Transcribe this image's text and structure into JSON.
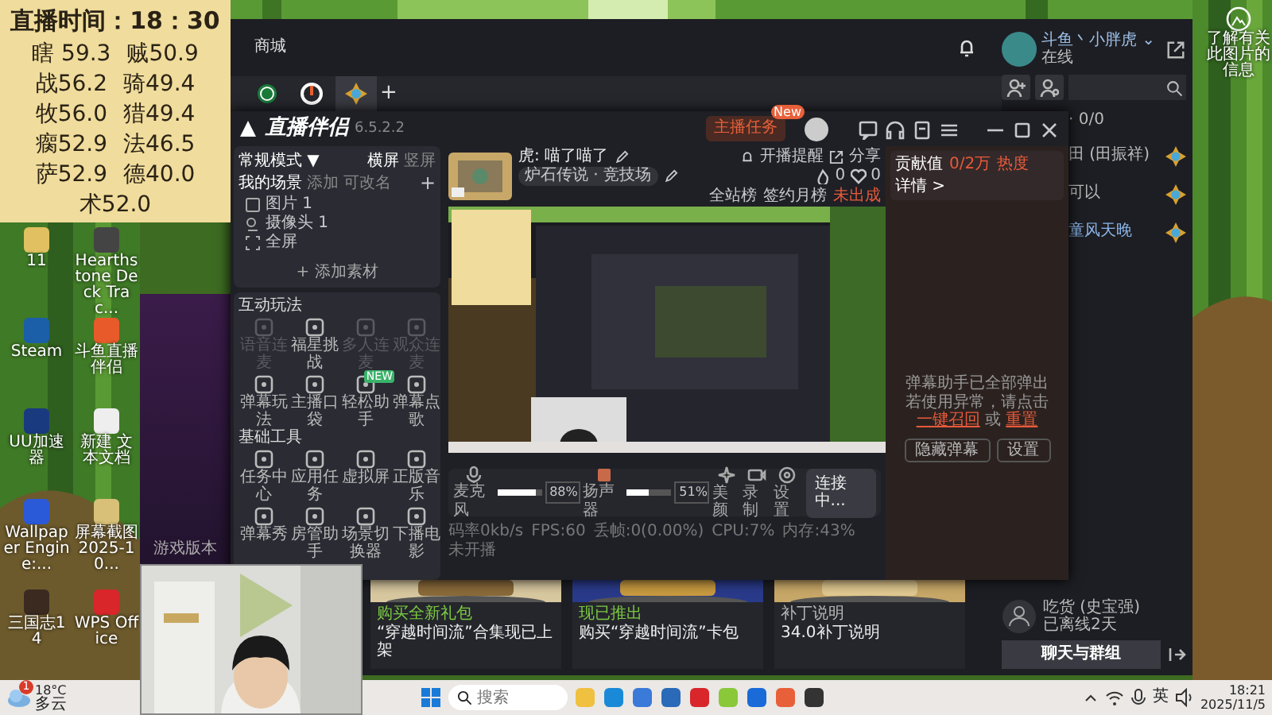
{
  "overlay_note": {
    "title": "直播时间：18：30",
    "rows": [
      [
        "瞎 59.3",
        "贼50.9"
      ],
      [
        "战56.2",
        "骑49.4"
      ],
      [
        "牧56.0",
        "猎49.4"
      ],
      [
        "瘸52.9",
        "法46.5"
      ],
      [
        "萨52.9",
        "德40.0"
      ],
      [
        "术52.0"
      ]
    ]
  },
  "desktop_icons": [
    {
      "label": "11"
    },
    {
      "label": "Hearthstone Deck Trac..."
    },
    {
      "label": "Steam"
    },
    {
      "label": "斗鱼直播伴侣"
    },
    {
      "label": "UU加速器"
    },
    {
      "label": "新建 文本文档"
    },
    {
      "label": "Wallpaper Engine:..."
    },
    {
      "label": "屏幕截图 2025-10..."
    },
    {
      "label": "三国志14"
    },
    {
      "label": "WPS Office"
    }
  ],
  "desktop_info": {
    "label": "了解有关此图片的信息"
  },
  "background_window": {
    "label": "游戏版本"
  },
  "launcher": {
    "nav": "商城",
    "user": {
      "name": "斗鱼丶小胖虎",
      "caret": "⌄",
      "status": "在线"
    },
    "game_tabs": [
      {
        "selected": false
      },
      {
        "selected": false
      },
      {
        "selected": true
      }
    ],
    "add_tab": "+",
    "friends_header": "· 0/0",
    "friends": [
      {
        "name": "田 (田振祥)"
      },
      {
        "name": "可以"
      },
      {
        "name": "童风天晚"
      }
    ],
    "offline_friend": {
      "name": "吃货 (史宝强)",
      "status": "已离线2天"
    },
    "chat_button": "聊天与群组",
    "news": [
      {
        "tag": "购买全新礼包",
        "color": "#7ac943",
        "title": "“穿越时间流”合集现已上架"
      },
      {
        "tag": "现已推出",
        "color": "#7ac943",
        "title": "购买“穿越时间流”卡包"
      },
      {
        "tag": "补丁说明",
        "color": "#b8b8b8",
        "title": "34.0补丁说明"
      }
    ]
  },
  "companion": {
    "app_name": "直播伴侣",
    "version": "6.5.2.2",
    "task_button": "主播任务",
    "task_badge": "New",
    "mode": "常规模式",
    "mode_caret": "▼",
    "layouts": [
      {
        "label": "横屏",
        "selected": true
      },
      {
        "label": "竖屏",
        "selected": false
      }
    ],
    "scenes_title": "我的场景",
    "scene_actions": [
      "添加",
      "可改名"
    ],
    "add_scene": "+",
    "sources": [
      {
        "label": "图片 1"
      },
      {
        "label": "摄像头 1"
      },
      {
        "label": "全屏"
      }
    ],
    "add_source": "+ 添加素材",
    "tool_groups": [
      {
        "title": "互动玩法",
        "tools": [
          {
            "label": "语音连麦",
            "disabled": true
          },
          {
            "label": "福星挑战",
            "disabled": false
          },
          {
            "label": "多人连麦",
            "disabled": true
          },
          {
            "label": "观众连麦",
            "disabled": true
          },
          {
            "label": "弹幕玩法",
            "disabled": false
          },
          {
            "label": "主播口袋",
            "disabled": false
          },
          {
            "label": "轻松助手",
            "disabled": false,
            "badge": "NEW"
          },
          {
            "label": "弹幕点歌",
            "disabled": false
          }
        ]
      },
      {
        "title": "基础工具",
        "tools": [
          {
            "label": "任务中心",
            "disabled": false
          },
          {
            "label": "应用任务",
            "disabled": false
          },
          {
            "label": "虚拟屏",
            "disabled": false
          },
          {
            "label": "正版音乐",
            "disabled": false
          },
          {
            "label": "弹幕秀",
            "disabled": false
          },
          {
            "label": "房管助手",
            "disabled": false
          },
          {
            "label": "场景切换器",
            "disabled": false
          },
          {
            "label": "下播电影",
            "disabled": false
          }
        ]
      }
    ],
    "room": {
      "title": "虎: 喵了喵了",
      "category": "炉石传说 · 竞技场",
      "actions": [
        "开播提醒",
        "分享"
      ],
      "ranks": [
        "全站榜",
        "签约月榜"
      ],
      "rank_status": "未出成",
      "heat": "0",
      "likes": "0"
    },
    "controls": {
      "mic": {
        "label": "麦克风",
        "level": 0.88,
        "reading": "88%"
      },
      "speaker": {
        "label": "扬声器",
        "level": 0.51,
        "reading": "51%"
      },
      "buttons": [
        "美颜",
        "录制",
        "设置"
      ],
      "connect": "连接中..."
    },
    "stats": [
      "码率0kb/s",
      "FPS:60",
      "丢帧:0(0.00%)",
      "CPU:7%",
      "内存:43%",
      "未开播"
    ],
    "contribution": {
      "label": "贡献值",
      "value": "0/2万",
      "heat": "热度",
      "details": "详情 >"
    },
    "danmaku": {
      "title": "弹幕助手已全部弹出",
      "prompt": "若使用异常，请点击",
      "recall": "一键召回",
      "or": "或",
      "reset": "重置",
      "buttons": [
        "隐藏弹幕",
        "设置"
      ]
    }
  },
  "taskbar": {
    "weather": {
      "temp": "18°C",
      "sky": "多云",
      "badge": "1"
    },
    "search": {
      "placeholder": "搜索"
    },
    "input_method": "英",
    "time": "18:21",
    "date": "2025/11/5"
  }
}
